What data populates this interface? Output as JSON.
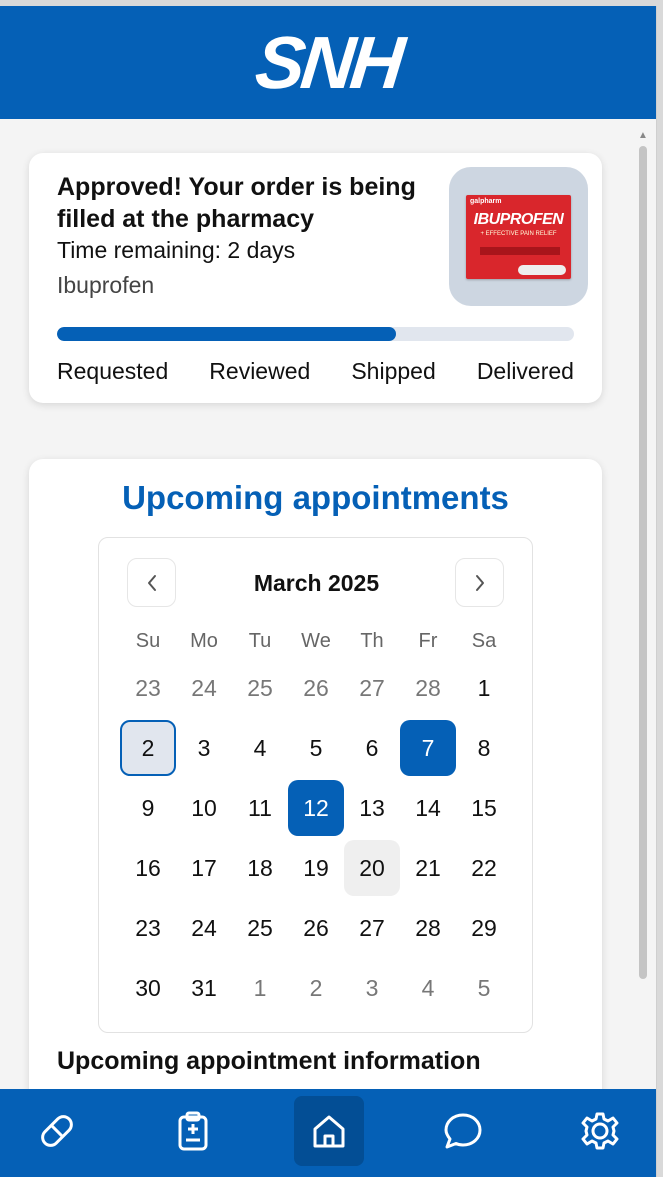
{
  "header": {
    "logo_text": "SNH"
  },
  "order": {
    "title": "Approved! Your order is being filled at the pharmacy",
    "time_remaining": "Time remaining: 2 days",
    "medication": "Ibuprofen",
    "image_label": "IBUPROFEN",
    "image_brand": "galpharm",
    "image_sub": "+ EFFECTIVE PAIN RELIEF",
    "progress_percent": 65.5,
    "steps": [
      "Requested",
      "Reviewed",
      "Shipped",
      "Delivered"
    ]
  },
  "appointments": {
    "title": "Upcoming appointments",
    "calendar": {
      "month_label": "March 2025",
      "weekdays": [
        "Su",
        "Mo",
        "Tu",
        "We",
        "Th",
        "Fr",
        "Sa"
      ],
      "weeks": [
        [
          {
            "d": "23",
            "muted": true
          },
          {
            "d": "24",
            "muted": true
          },
          {
            "d": "25",
            "muted": true
          },
          {
            "d": "26",
            "muted": true
          },
          {
            "d": "27",
            "muted": true
          },
          {
            "d": "28",
            "muted": true
          },
          {
            "d": "1"
          }
        ],
        [
          {
            "d": "2",
            "state": "selected"
          },
          {
            "d": "3"
          },
          {
            "d": "4"
          },
          {
            "d": "5"
          },
          {
            "d": "6"
          },
          {
            "d": "7",
            "state": "appt"
          },
          {
            "d": "8"
          }
        ],
        [
          {
            "d": "9"
          },
          {
            "d": "10"
          },
          {
            "d": "11"
          },
          {
            "d": "12",
            "state": "appt"
          },
          {
            "d": "13"
          },
          {
            "d": "14"
          },
          {
            "d": "15"
          }
        ],
        [
          {
            "d": "16"
          },
          {
            "d": "17"
          },
          {
            "d": "18"
          },
          {
            "d": "19"
          },
          {
            "d": "20",
            "state": "today"
          },
          {
            "d": "21"
          },
          {
            "d": "22"
          }
        ],
        [
          {
            "d": "23"
          },
          {
            "d": "24"
          },
          {
            "d": "25"
          },
          {
            "d": "26"
          },
          {
            "d": "27"
          },
          {
            "d": "28"
          },
          {
            "d": "29"
          }
        ],
        [
          {
            "d": "30"
          },
          {
            "d": "31"
          },
          {
            "d": "1",
            "muted": true
          },
          {
            "d": "2",
            "muted": true
          },
          {
            "d": "3",
            "muted": true
          },
          {
            "d": "4",
            "muted": true
          },
          {
            "d": "5",
            "muted": true
          }
        ]
      ]
    },
    "info_heading": "Upcoming appointment information"
  },
  "bottom_nav": {
    "items": [
      {
        "name": "pill-icon",
        "active": false
      },
      {
        "name": "medical-records-icon",
        "active": false
      },
      {
        "name": "home-icon",
        "active": true
      },
      {
        "name": "chat-icon",
        "active": false
      },
      {
        "name": "settings-icon",
        "active": false
      }
    ]
  },
  "colors": {
    "brand": "#0560b6",
    "brand_dark": "#034e95",
    "selected_bg": "#e1e6ee",
    "today_bg": "#efefef"
  }
}
